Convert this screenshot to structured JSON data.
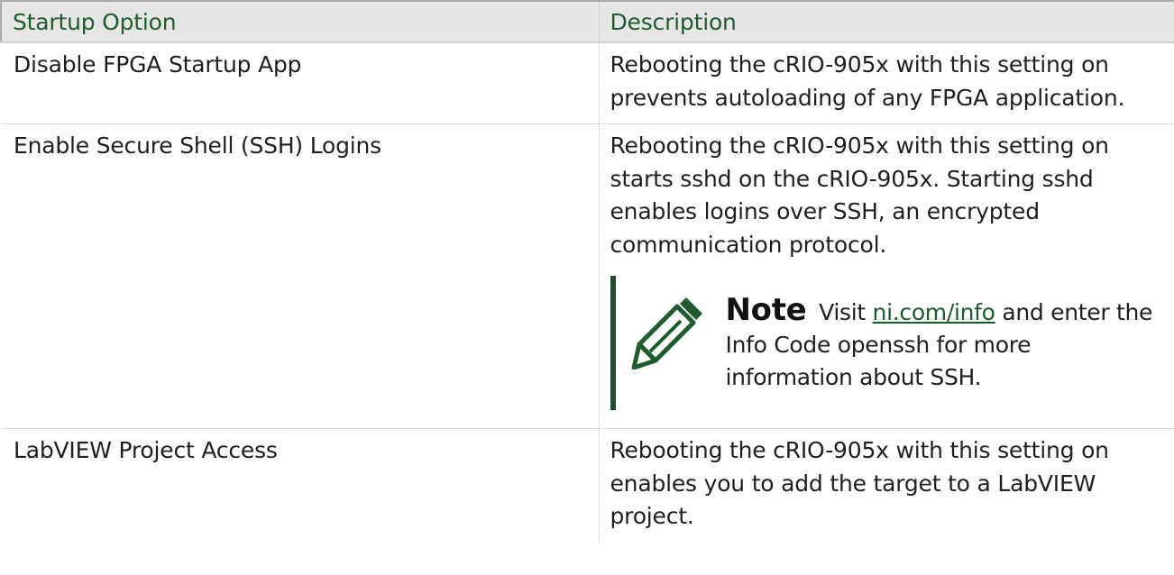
{
  "table": {
    "headers": {
      "option": "Startup Option",
      "description": "Description"
    },
    "rows": [
      {
        "option": "Disable FPGA Startup App",
        "description": "Rebooting the cRIO-905x with this setting on prevents autoloading of any FPGA application."
      },
      {
        "option": "Enable Secure Shell (SSH) Logins",
        "description": "Rebooting the cRIO-905x with this setting on starts sshd on the cRIO-905x. Starting sshd enables logins over SSH, an encrypted communication protocol.",
        "note": {
          "icon": "pencil-icon",
          "title": "Note",
          "text_before": "Visit",
          "link": "ni.com/info",
          "text_after": "and enter the Info Code openssh for more information about SSH."
        }
      },
      {
        "option": "LabVIEW Project Access",
        "description": "Rebooting the cRIO-905x with this setting on enables you to add the target to a LabVIEW project."
      }
    ]
  },
  "colors": {
    "header_text": "#1f5b2c",
    "header_bg": "#e6e6e6",
    "note_bar": "#1f4d2b",
    "link": "#1a5a2c"
  }
}
